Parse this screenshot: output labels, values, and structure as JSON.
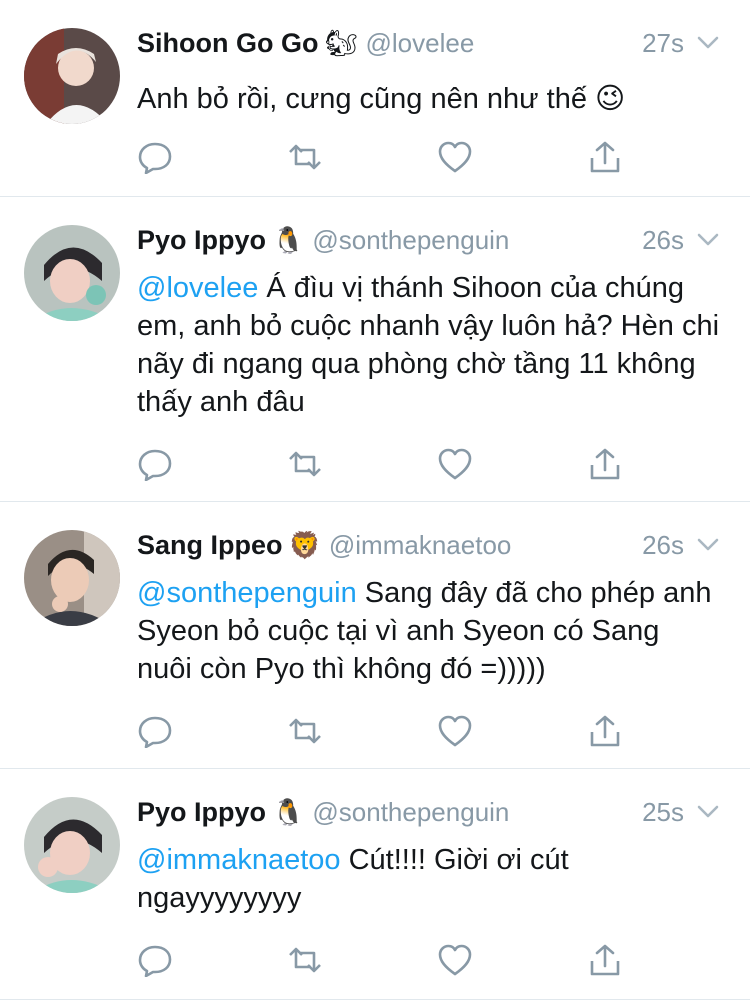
{
  "tweets": [
    {
      "name": "Sihoon Go Go",
      "badge_emoji": "🐿",
      "handle": "@lovelee",
      "time": "27s",
      "mention": "",
      "text": "Anh bỏ rồi, cưng cũng nên như thế 😉"
    },
    {
      "name": "Pyo Ippyo",
      "badge_emoji": "🐧",
      "handle": "@sonthepenguin",
      "time": "26s",
      "mention": "@lovelee",
      "text": " Á đìu vị thánh Sihoon của chúng em, anh bỏ cuộc nhanh vậy luôn hả? Hèn chi nãy đi ngang qua phòng chờ tầng 11 không thấy anh đâu"
    },
    {
      "name": "Sang Ippeo",
      "badge_emoji": "🦁",
      "handle": "@immaknaetoo",
      "time": "26s",
      "mention": "@sonthepenguin",
      "text": " Sang đây đã cho phép anh Syeon bỏ cuộc tại vì anh Syeon có Sang nuôi còn Pyo thì không đó =)))))"
    },
    {
      "name": "Pyo Ippyo",
      "badge_emoji": "🐧",
      "handle": "@sonthepenguin",
      "time": "25s",
      "mention": "@immaknaetoo",
      "text": " Cút!!!! Giời ơi cút ngayyyyyyyy"
    }
  ],
  "colors": {
    "mention": "#1da1f2",
    "secondary_text": "#8899a6",
    "primary_text": "#14171a",
    "divider": "#e1e8ed"
  },
  "icons": [
    "reply-icon",
    "retweet-icon",
    "like-icon",
    "share-icon",
    "chevron-down-icon"
  ]
}
